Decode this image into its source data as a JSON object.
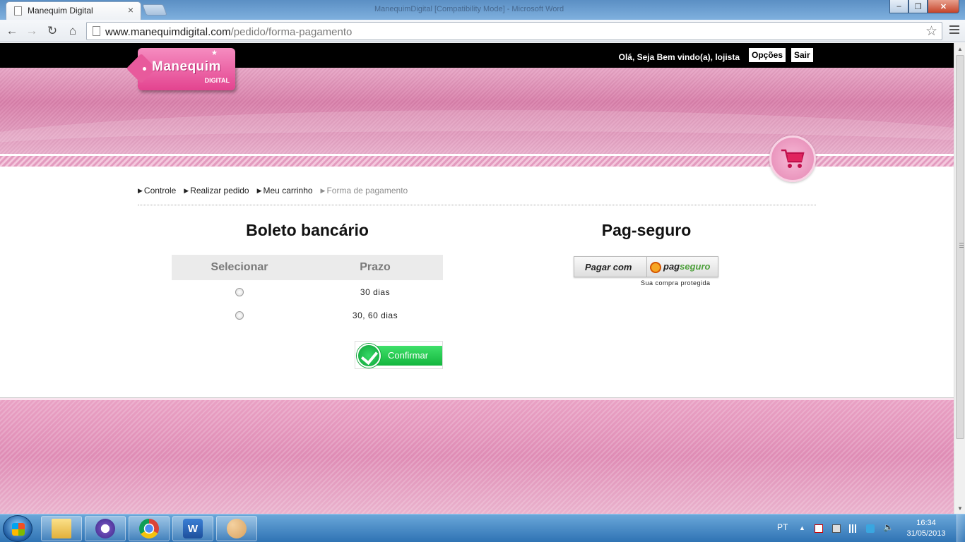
{
  "browser": {
    "tab_title": "Manequim Digital",
    "tab_close": "×",
    "window_title": "ManequimDigital [Compatibility Mode] - Microsoft Word",
    "url_host": "www.manequimdigital.com",
    "url_path": "/pedido/forma-pagamento",
    "minimize": "‒",
    "maximize": "❐",
    "close": "✕"
  },
  "header": {
    "logo_text": "Manequim",
    "logo_sub": "DIGITAL",
    "greeting": "Olá, Seja Bem vindo(a), lojista",
    "options_label": "Opções",
    "logout_label": "Sair"
  },
  "breadcrumb": [
    {
      "label": "Controle"
    },
    {
      "label": "Realizar pedido"
    },
    {
      "label": "Meu carrinho"
    },
    {
      "label": "Forma de pagamento"
    }
  ],
  "boleto": {
    "title": "Boleto bancário",
    "headers": [
      "Selecionar",
      "Prazo"
    ],
    "rows": [
      {
        "prazo": "30 dias",
        "selected": false
      },
      {
        "prazo": "30, 60 dias",
        "selected": false
      }
    ],
    "confirm_label": "Confirmar"
  },
  "pagseguro": {
    "title": "Pag-seguro",
    "button_left": "Pagar com",
    "brand_pag": "pag",
    "brand_seguro": "seguro",
    "subtitle": "Sua compra protegida"
  },
  "taskbar": {
    "language": "PT",
    "time": "16:34",
    "date": "31/05/2013",
    "word_icon_text": "W"
  },
  "colors": {
    "brand_pink": "#e3438f",
    "confirm_green": "#14b63e",
    "header_bar": "#000000"
  }
}
